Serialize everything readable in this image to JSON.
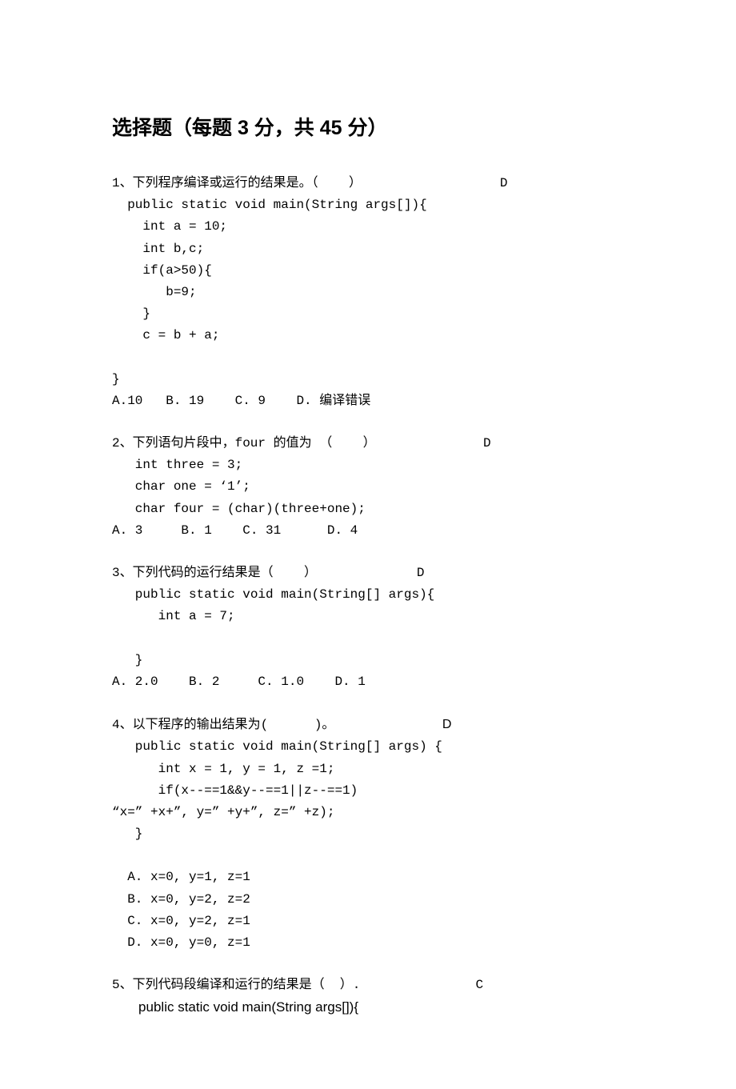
{
  "title": "选择题（每题 3 分，共 45 分）",
  "q1": {
    "stem": "1、下列程序编译或运行的结果是。（    ）",
    "ans": "D",
    "code1": "  public static void main(String args[]){",
    "code2": "    int a = 10;",
    "code3": "    int b,c;",
    "code4": "    if(a>50){",
    "code5": "       b=9;",
    "code6": "    }",
    "code7": "    c = b + a;",
    "code8": "}",
    "opts": "A.10   B. 19    C. 9    D. 编译错误"
  },
  "q2": {
    "stem": "2、下列语句片段中，four 的值为 （    ）",
    "ans": "D",
    "code1": "   int three = 3;",
    "code2": "   char one = ‘1’;",
    "code3": "   char four = (char)(three+one);",
    "opts": "A. 3     B. 1    C. 31      D. 4"
  },
  "q3": {
    "stem": "3、下列代码的运行结果是（    ）",
    "ans": "D",
    "code1": "   public static void main(String[] args){",
    "code2": "      int a = 7;",
    "code3": "",
    "code4": "   }",
    "opts": "A. 2.0    B. 2     C. 1.0    D. 1"
  },
  "q4": {
    "stem": "4、以下程序的输出结果为(      )。",
    "ans": "D",
    "code1": "   public static void main(String[] args) {",
    "code2": "      int x = 1, y = 1, z =1;",
    "code3": "      if(x--==1&&y--==1||z--==1)",
    "code4": "“x=” +x+”, y=” +y+”, z=” +z);",
    "code5": "   }",
    "optA": "  A. x=0, y=1, z=1",
    "optB": "  B. x=0, y=2, z=2",
    "optC": "  C. x=0, y=2, z=1",
    "optD": "  D. x=0, y=0, z=1"
  },
  "q5": {
    "stem": "5、下列代码段编译和运行的结果是（  ）.",
    "ans": "C",
    "code1": "       public static void main(String args[]){"
  }
}
